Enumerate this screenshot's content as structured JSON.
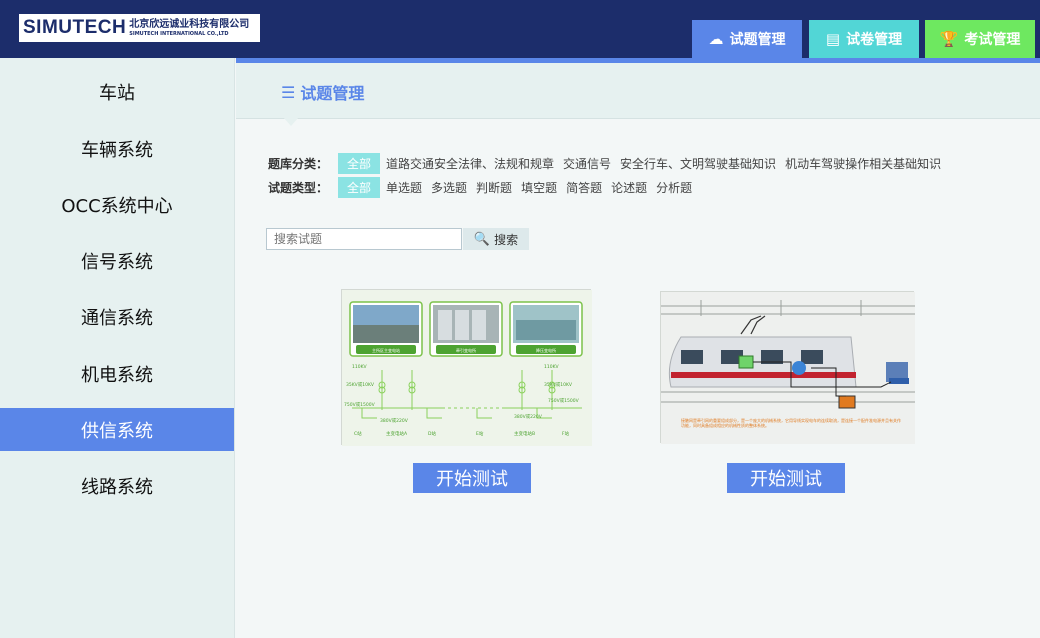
{
  "brand": {
    "name": "SIMUTECH",
    "cn_name": "北京欣远诚业科技有限公司",
    "en_name": "SIMUTECH INTERNATIONAL CO.,LTD"
  },
  "nav": {
    "tabs": [
      {
        "label": "试题管理",
        "icon": "cloud-icon"
      },
      {
        "label": "试卷管理",
        "icon": "papers-icon"
      },
      {
        "label": "考试管理",
        "icon": "trophy-icon"
      }
    ]
  },
  "sidebar": {
    "items": [
      {
        "label": "车站"
      },
      {
        "label": "车辆系统"
      },
      {
        "label": "OCC系统中心"
      },
      {
        "label": "信号系统"
      },
      {
        "label": "通信系统"
      },
      {
        "label": "机电系统"
      },
      {
        "label": "供信系统"
      },
      {
        "label": "线路系统"
      }
    ],
    "active_index": 6
  },
  "page": {
    "title": "试题管理",
    "title_icon": "list-icon"
  },
  "filters": {
    "category": {
      "label": "题库分类：",
      "all": "全部",
      "options": [
        "道路交通安全法律、法规和规章",
        "交通信号",
        "安全行车、文明驾驶基础知识",
        "机动车驾驶操作相关基础知识"
      ]
    },
    "type": {
      "label": "试题类型：",
      "all": "全部",
      "options": [
        "单选题",
        "多选题",
        "判断题",
        "填空题",
        "简答题",
        "论述题",
        "分析题"
      ]
    }
  },
  "search": {
    "placeholder": "搜索试题",
    "button_label": "搜索"
  },
  "cards": [
    {
      "image_labels": [
        "主所区主变电站",
        "牵引变电所",
        "降压变电所"
      ],
      "diagram_labels": [
        "110KV",
        "35KV或10KV",
        "750V或1500V",
        "380V或220V",
        "C站",
        "主变电站A",
        "D站",
        "E站",
        "主变电站B",
        "F站"
      ],
      "button": "开始测试"
    },
    {
      "caption": "接触网是牵引网的重要组成部分，是一个庞大的机械系统，它用导线实现电车的连续取流，是连接一个配件准电源并且有关作功能，同时具备组成相应的机械性质的整体系统。",
      "button": "开始测试"
    }
  ],
  "colors": {
    "header_bg": "#1c2d6b",
    "accent": "#5a86e8",
    "tab_cyan": "#52d6d6",
    "tab_green": "#6ee860",
    "pill": "#8be3e3",
    "sidebar_bg": "#e6f1f0"
  }
}
